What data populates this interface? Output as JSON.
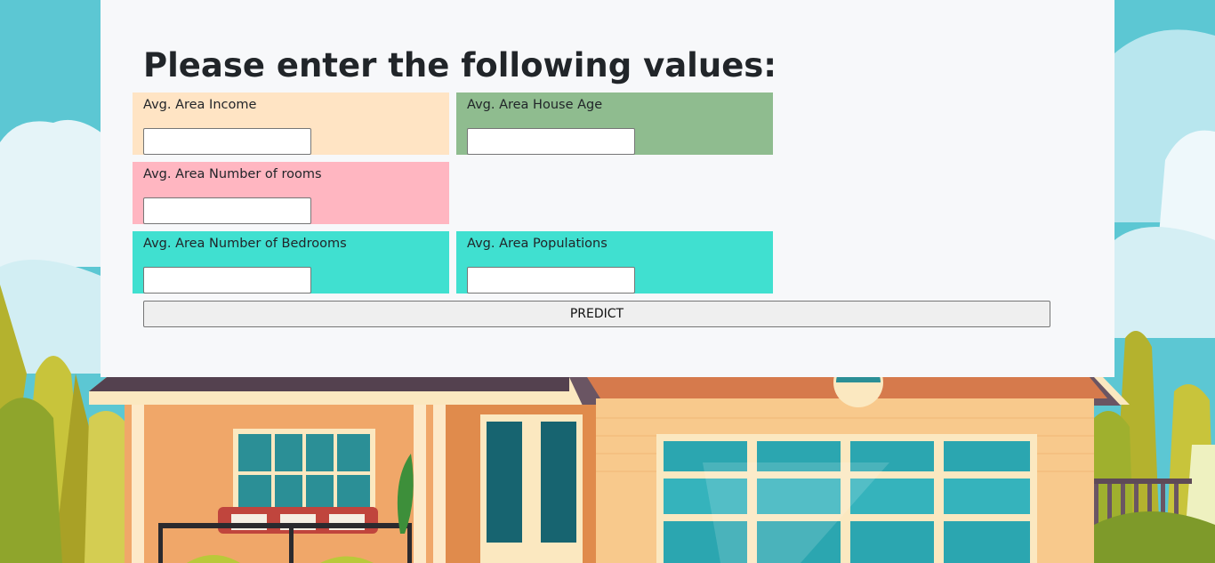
{
  "form": {
    "heading": "Please enter the following values:",
    "fields": [
      {
        "label": "Avg. Area Income",
        "value": "",
        "color": "#ffe4c4"
      },
      {
        "label": "Avg. Area House Age",
        "value": "",
        "color": "#8fbc8f"
      },
      {
        "label": "Avg. Area Number of rooms",
        "value": "",
        "color": "#ffb6c1"
      },
      {
        "label": "Avg. Area Number of Bedrooms",
        "value": "",
        "color": "#40e0d0"
      },
      {
        "label": "Avg. Area Populations",
        "value": "",
        "color": "#40e0d0"
      }
    ],
    "predict_label": "PREDICT"
  },
  "colors": {
    "panel": "#f7f8fa",
    "sky": "#5cc7d3",
    "house_wall": "#f5c27c",
    "window_glass": "#2ba6b0"
  }
}
